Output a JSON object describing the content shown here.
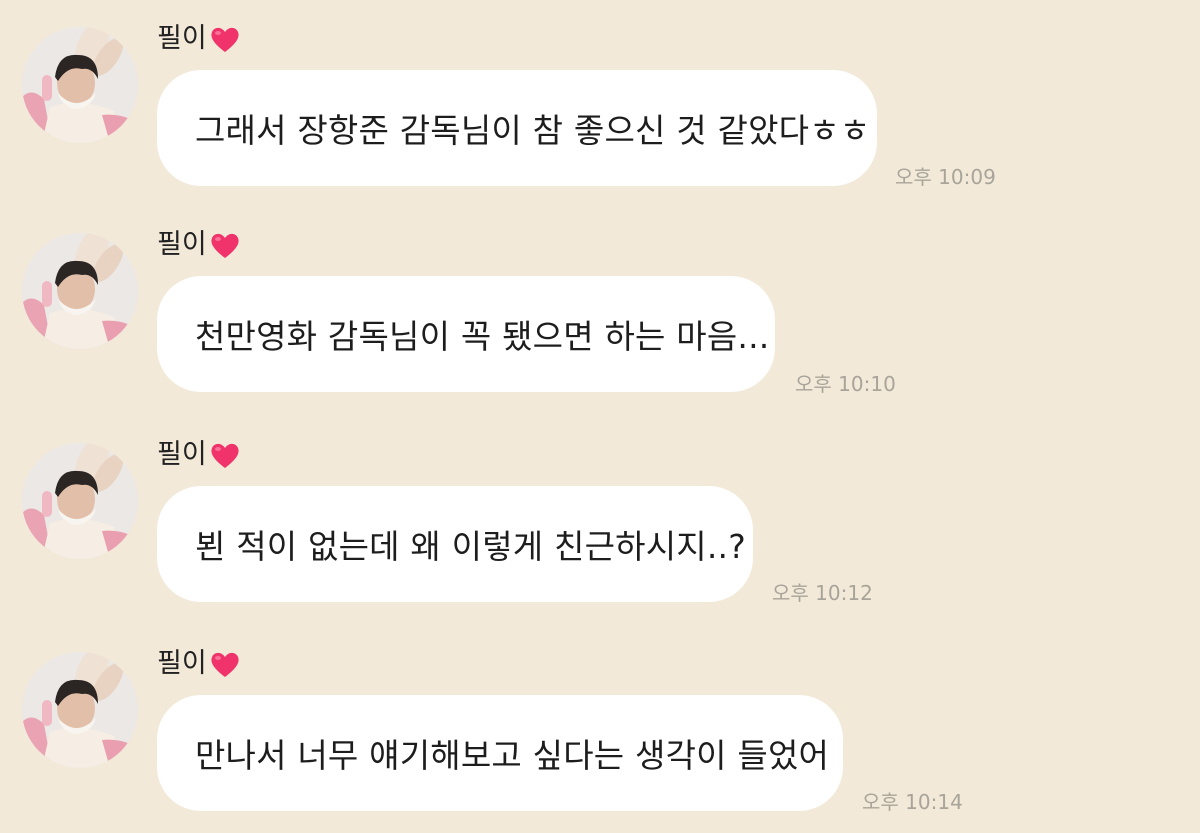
{
  "messages": [
    {
      "sender": "필이",
      "text": "그래서 장항준 감독님이 참 좋으신 것 같았다ㅎㅎ",
      "time": "오후 10:09"
    },
    {
      "sender": "필이",
      "text": "천만영화 감독님이 꼭 됐으면 하는 마음...",
      "time": "오후 10:10"
    },
    {
      "sender": "필이",
      "text": "뵌 적이 없는데 왜 이렇게 친근하시지..?",
      "time": "오후 10:12"
    },
    {
      "sender": "필이",
      "text": "만나서 너무 얘기해보고 싶다는 생각이 들었어",
      "time": "오후 10:14"
    }
  ],
  "colors": {
    "background": "#f2e9d8",
    "bubble": "#ffffff",
    "heart": "#f0336a",
    "timestamp": "#a9a49a"
  },
  "icons": {
    "heart": "heart-icon",
    "avatar": "profile-photo"
  }
}
